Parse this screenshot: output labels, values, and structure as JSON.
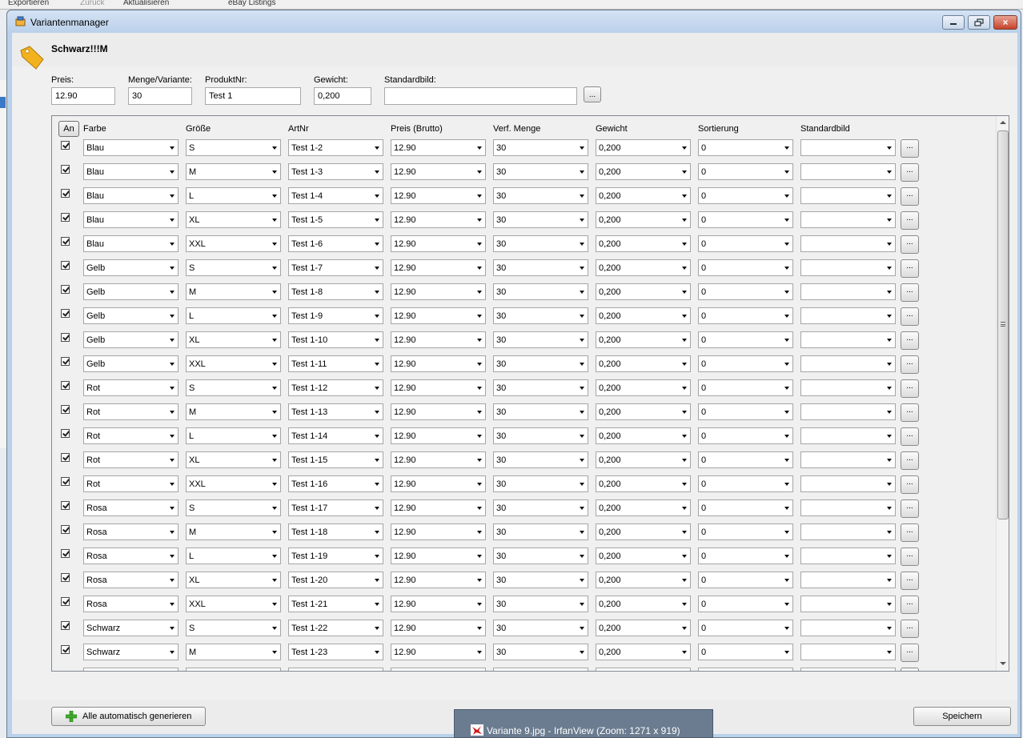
{
  "background": {
    "tabs": [
      "Exportieren",
      "Zurück",
      "Aktualisieren",
      "eBay Listings"
    ]
  },
  "window": {
    "title": "Variantenmanager",
    "controls": {
      "minimize": "minimize-icon",
      "maximize": "maximize-icon",
      "close": "×"
    }
  },
  "header": {
    "product_name": "Schwarz!!!M",
    "fields": {
      "preis": {
        "label": "Preis:",
        "value": "12.90"
      },
      "menge": {
        "label": "Menge/Variante:",
        "value": "30"
      },
      "produktnr": {
        "label": "ProduktNr:",
        "value": "Test 1"
      },
      "gewicht": {
        "label": "Gewicht:",
        "value": "0,200"
      },
      "standardbild": {
        "label": "Standardbild:",
        "value": ""
      }
    },
    "browse_label": "..."
  },
  "grid": {
    "an_label": "An",
    "columns": [
      "Farbe",
      "Größe",
      "ArtNr",
      "Preis (Brutto)",
      "Verf. Menge",
      "Gewicht",
      "Sortierung",
      "Standardbild"
    ],
    "dots_label": "...",
    "rows": [
      {
        "checked": true,
        "farbe": "Blau",
        "groesse": "S",
        "artnr": "Test 1-2",
        "preis": "12.90",
        "menge": "30",
        "gewicht": "0,200",
        "sortierung": "0",
        "bild": ""
      },
      {
        "checked": true,
        "farbe": "Blau",
        "groesse": "M",
        "artnr": "Test 1-3",
        "preis": "12.90",
        "menge": "30",
        "gewicht": "0,200",
        "sortierung": "0",
        "bild": ""
      },
      {
        "checked": true,
        "farbe": "Blau",
        "groesse": "L",
        "artnr": "Test 1-4",
        "preis": "12.90",
        "menge": "30",
        "gewicht": "0,200",
        "sortierung": "0",
        "bild": ""
      },
      {
        "checked": true,
        "farbe": "Blau",
        "groesse": "XL",
        "artnr": "Test 1-5",
        "preis": "12.90",
        "menge": "30",
        "gewicht": "0,200",
        "sortierung": "0",
        "bild": ""
      },
      {
        "checked": true,
        "farbe": "Blau",
        "groesse": "XXL",
        "artnr": "Test 1-6",
        "preis": "12.90",
        "menge": "30",
        "gewicht": "0,200",
        "sortierung": "0",
        "bild": ""
      },
      {
        "checked": true,
        "farbe": "Gelb",
        "groesse": "S",
        "artnr": "Test 1-7",
        "preis": "12.90",
        "menge": "30",
        "gewicht": "0,200",
        "sortierung": "0",
        "bild": ""
      },
      {
        "checked": true,
        "farbe": "Gelb",
        "groesse": "M",
        "artnr": "Test 1-8",
        "preis": "12.90",
        "menge": "30",
        "gewicht": "0,200",
        "sortierung": "0",
        "bild": ""
      },
      {
        "checked": true,
        "farbe": "Gelb",
        "groesse": "L",
        "artnr": "Test 1-9",
        "preis": "12.90",
        "menge": "30",
        "gewicht": "0,200",
        "sortierung": "0",
        "bild": ""
      },
      {
        "checked": true,
        "farbe": "Gelb",
        "groesse": "XL",
        "artnr": "Test 1-10",
        "preis": "12.90",
        "menge": "30",
        "gewicht": "0,200",
        "sortierung": "0",
        "bild": ""
      },
      {
        "checked": true,
        "farbe": "Gelb",
        "groesse": "XXL",
        "artnr": "Test 1-11",
        "preis": "12.90",
        "menge": "30",
        "gewicht": "0,200",
        "sortierung": "0",
        "bild": ""
      },
      {
        "checked": true,
        "farbe": "Rot",
        "groesse": "S",
        "artnr": "Test 1-12",
        "preis": "12.90",
        "menge": "30",
        "gewicht": "0,200",
        "sortierung": "0",
        "bild": ""
      },
      {
        "checked": true,
        "farbe": "Rot",
        "groesse": "M",
        "artnr": "Test 1-13",
        "preis": "12.90",
        "menge": "30",
        "gewicht": "0,200",
        "sortierung": "0",
        "bild": ""
      },
      {
        "checked": true,
        "farbe": "Rot",
        "groesse": "L",
        "artnr": "Test 1-14",
        "preis": "12.90",
        "menge": "30",
        "gewicht": "0,200",
        "sortierung": "0",
        "bild": ""
      },
      {
        "checked": true,
        "farbe": "Rot",
        "groesse": "XL",
        "artnr": "Test 1-15",
        "preis": "12.90",
        "menge": "30",
        "gewicht": "0,200",
        "sortierung": "0",
        "bild": ""
      },
      {
        "checked": true,
        "farbe": "Rot",
        "groesse": "XXL",
        "artnr": "Test 1-16",
        "preis": "12.90",
        "menge": "30",
        "gewicht": "0,200",
        "sortierung": "0",
        "bild": ""
      },
      {
        "checked": true,
        "farbe": "Rosa",
        "groesse": "S",
        "artnr": "Test 1-17",
        "preis": "12.90",
        "menge": "30",
        "gewicht": "0,200",
        "sortierung": "0",
        "bild": ""
      },
      {
        "checked": true,
        "farbe": "Rosa",
        "groesse": "M",
        "artnr": "Test 1-18",
        "preis": "12.90",
        "menge": "30",
        "gewicht": "0,200",
        "sortierung": "0",
        "bild": ""
      },
      {
        "checked": true,
        "farbe": "Rosa",
        "groesse": "L",
        "artnr": "Test 1-19",
        "preis": "12.90",
        "menge": "30",
        "gewicht": "0,200",
        "sortierung": "0",
        "bild": ""
      },
      {
        "checked": true,
        "farbe": "Rosa",
        "groesse": "XL",
        "artnr": "Test 1-20",
        "preis": "12.90",
        "menge": "30",
        "gewicht": "0,200",
        "sortierung": "0",
        "bild": ""
      },
      {
        "checked": true,
        "farbe": "Rosa",
        "groesse": "XXL",
        "artnr": "Test 1-21",
        "preis": "12.90",
        "menge": "30",
        "gewicht": "0,200",
        "sortierung": "0",
        "bild": ""
      },
      {
        "checked": true,
        "farbe": "Schwarz",
        "groesse": "S",
        "artnr": "Test 1-22",
        "preis": "12.90",
        "menge": "30",
        "gewicht": "0,200",
        "sortierung": "0",
        "bild": ""
      },
      {
        "checked": true,
        "farbe": "Schwarz",
        "groesse": "M",
        "artnr": "Test 1-23",
        "preis": "12.90",
        "menge": "30",
        "gewicht": "0,200",
        "sortierung": "0",
        "bild": ""
      }
    ]
  },
  "footer": {
    "generate_label": "Alle automatisch generieren",
    "save_label": "Speichern"
  },
  "taskbar": {
    "thumbnail_label": "Variante 9.jpg - IrfanView (Zoom: 1271 x 919)"
  }
}
